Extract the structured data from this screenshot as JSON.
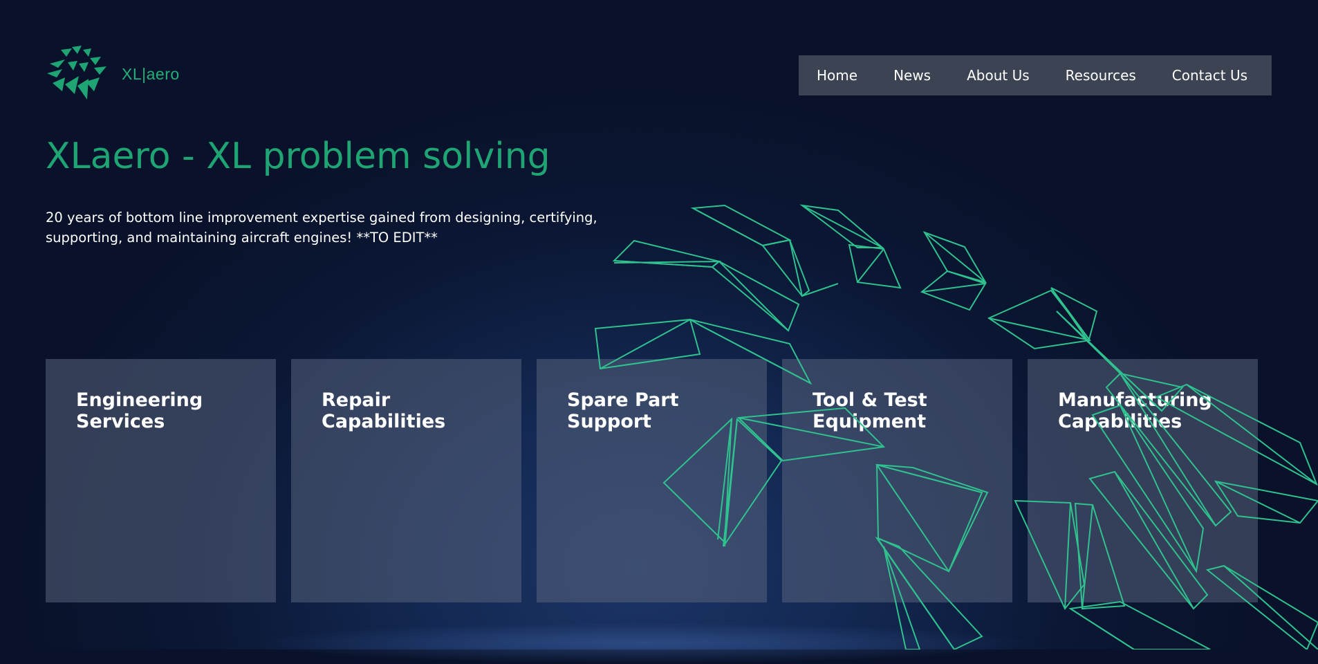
{
  "brand": {
    "logo_text": "XL|aero"
  },
  "nav": {
    "items": [
      {
        "label": "Home"
      },
      {
        "label": "News"
      },
      {
        "label": "About Us"
      },
      {
        "label": "Resources"
      },
      {
        "label": "Contact Us"
      }
    ]
  },
  "hero": {
    "title": "XLaero - XL problem solving",
    "subtitle": "20 years of bottom line improvement expertise gained from designing, certifying, supporting, and maintaining aircraft engines! **TO EDIT**"
  },
  "cards": [
    {
      "line1": "Engineering",
      "line2": "Services"
    },
    {
      "line1": "Repair",
      "line2": "Capabilities"
    },
    {
      "line1": "Spare Part",
      "line2": "Support"
    },
    {
      "line1": "Tool & Test",
      "line2": "Equipment"
    },
    {
      "line1": "Manufacturing",
      "line2": "Capabilities"
    }
  ],
  "colors": {
    "accent_green": "#1fa574",
    "nav_bg": "#3c4353",
    "card_bg": "#4a5570",
    "page_bg": "#09122a"
  },
  "icons": {
    "logo": "turbine-blades-logo-icon",
    "background_art": "turbine-blades-line-art"
  }
}
